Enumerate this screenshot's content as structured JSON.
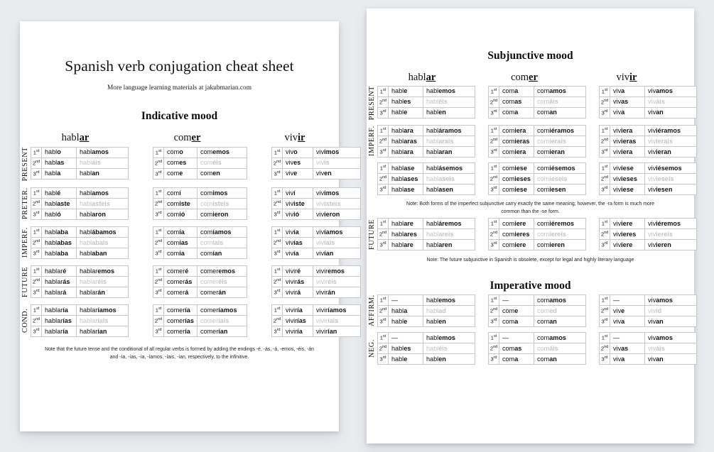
{
  "document": {
    "title": "Spanish verb conjugation cheat sheet",
    "subtitle": "More language learning materials at jakubmarian.com"
  },
  "moods": {
    "indicative": "Indicative mood",
    "subjunctive": "Subjunctive mood",
    "imperative": "Imperative mood"
  },
  "verbs": {
    "hablar": {
      "stem": "habl",
      "ending": "ar"
    },
    "comer": {
      "stem": "com",
      "ending": "er"
    },
    "vivir": {
      "stem": "viv",
      "ending": "ir"
    }
  },
  "persons": {
    "first": "1",
    "second": "2",
    "third": "3",
    "first_sup": "st",
    "second_sup": "nd",
    "third_sup": "rd"
  },
  "tense_labels": {
    "present": "PRESENT",
    "preterite": "PRETER.",
    "imperfect": "IMPERF.",
    "future": "FUTURE",
    "conditional": "COND.",
    "affirmative": "AFFIRM.",
    "negative": "NEG."
  },
  "notes": {
    "future_conditional": "Note that the future tense and the conditional of all regular verbs is formed by adding the endings -é, -ás, -á, -emos, -éis, -án and -ía, -ías, -ía, -íamos, -íais, -ían, respectively, to the infinitive.",
    "imperfect_subjunctive": "Note: Both forms of the imperfect subjunctive carry exactly the same meaning; however, the -ra form is much more common than the -se form.",
    "future_subjunctive": "Note: The future subjunctive in Spanish is obsolete, except for legal and highly literary language"
  },
  "tables": {
    "ind_present": {
      "hablar": [
        [
          "habl",
          "o"
        ],
        [
          "habl",
          "amos"
        ],
        [
          "habl",
          "as"
        ],
        [
          "habl",
          "áis"
        ],
        [
          "habl",
          "a"
        ],
        [
          "habl",
          "an"
        ]
      ],
      "comer": [
        [
          "com",
          "o"
        ],
        [
          "com",
          "emos"
        ],
        [
          "com",
          "es"
        ],
        [
          "com",
          "éis"
        ],
        [
          "com",
          "e"
        ],
        [
          "com",
          "en"
        ]
      ],
      "vivir": [
        [
          "viv",
          "o"
        ],
        [
          "viv",
          "imos"
        ],
        [
          "viv",
          "es"
        ],
        [
          "viv",
          "ís"
        ],
        [
          "viv",
          "e"
        ],
        [
          "viv",
          "en"
        ]
      ]
    },
    "ind_preterite": {
      "hablar": [
        [
          "habl",
          "é"
        ],
        [
          "habl",
          "amos"
        ],
        [
          "habl",
          "aste"
        ],
        [
          "habl",
          "asteis"
        ],
        [
          "habl",
          "ó"
        ],
        [
          "habl",
          "aron"
        ]
      ],
      "comer": [
        [
          "com",
          "í"
        ],
        [
          "com",
          "imos"
        ],
        [
          "com",
          "iste"
        ],
        [
          "com",
          "isteis"
        ],
        [
          "com",
          "ió"
        ],
        [
          "com",
          "ieron"
        ]
      ],
      "vivir": [
        [
          "viv",
          "í"
        ],
        [
          "viv",
          "imos"
        ],
        [
          "viv",
          "iste"
        ],
        [
          "viv",
          "isteis"
        ],
        [
          "viv",
          "ió"
        ],
        [
          "viv",
          "ieron"
        ]
      ]
    },
    "ind_imperfect": {
      "hablar": [
        [
          "habl",
          "aba"
        ],
        [
          "habl",
          "ábamos"
        ],
        [
          "habl",
          "abas"
        ],
        [
          "habl",
          "abais"
        ],
        [
          "habl",
          "aba"
        ],
        [
          "habl",
          "aban"
        ]
      ],
      "comer": [
        [
          "com",
          "ía"
        ],
        [
          "com",
          "íamos"
        ],
        [
          "com",
          "ías"
        ],
        [
          "com",
          "íais"
        ],
        [
          "com",
          "ía"
        ],
        [
          "com",
          "ían"
        ]
      ],
      "vivir": [
        [
          "viv",
          "ía"
        ],
        [
          "viv",
          "íamos"
        ],
        [
          "viv",
          "ías"
        ],
        [
          "viv",
          "íais"
        ],
        [
          "viv",
          "ía"
        ],
        [
          "viv",
          "ían"
        ]
      ]
    },
    "ind_future": {
      "hablar": [
        [
          "hablar",
          "é"
        ],
        [
          "hablar",
          "emos"
        ],
        [
          "hablar",
          "ás"
        ],
        [
          "hablar",
          "éis"
        ],
        [
          "hablar",
          "á"
        ],
        [
          "hablar",
          "án"
        ]
      ],
      "comer": [
        [
          "comer",
          "é"
        ],
        [
          "comer",
          "emos"
        ],
        [
          "comer",
          "ás"
        ],
        [
          "comer",
          "éis"
        ],
        [
          "comer",
          "á"
        ],
        [
          "comer",
          "án"
        ]
      ],
      "vivir": [
        [
          "vivir",
          "é"
        ],
        [
          "vivir",
          "emos"
        ],
        [
          "vivir",
          "ás"
        ],
        [
          "vivir",
          "éis"
        ],
        [
          "vivir",
          "á"
        ],
        [
          "vivir",
          "án"
        ]
      ]
    },
    "ind_conditional": {
      "hablar": [
        [
          "hablar",
          "ía"
        ],
        [
          "hablar",
          "íamos"
        ],
        [
          "hablar",
          "ías"
        ],
        [
          "hablar",
          "íais"
        ],
        [
          "hablar",
          "ía"
        ],
        [
          "hablar",
          "ían"
        ]
      ],
      "comer": [
        [
          "comer",
          "ía"
        ],
        [
          "comer",
          "íamos"
        ],
        [
          "comer",
          "ías"
        ],
        [
          "comer",
          "íais"
        ],
        [
          "comer",
          "ía"
        ],
        [
          "comer",
          "ían"
        ]
      ],
      "vivir": [
        [
          "vivir",
          "ía"
        ],
        [
          "vivir",
          "íamos"
        ],
        [
          "vivir",
          "ías"
        ],
        [
          "vivir",
          "íais"
        ],
        [
          "vivir",
          "ía"
        ],
        [
          "vivir",
          "ían"
        ]
      ]
    },
    "subj_present": {
      "hablar": [
        [
          "habl",
          "e"
        ],
        [
          "habl",
          "emos"
        ],
        [
          "habl",
          "es"
        ],
        [
          "habl",
          "éis"
        ],
        [
          "habl",
          "e"
        ],
        [
          "habl",
          "en"
        ]
      ],
      "comer": [
        [
          "com",
          "a"
        ],
        [
          "com",
          "amos"
        ],
        [
          "com",
          "as"
        ],
        [
          "com",
          "áis"
        ],
        [
          "com",
          "a"
        ],
        [
          "com",
          "an"
        ]
      ],
      "vivir": [
        [
          "viv",
          "a"
        ],
        [
          "viv",
          "amos"
        ],
        [
          "viv",
          "as"
        ],
        [
          "viv",
          "áis"
        ],
        [
          "viv",
          "a"
        ],
        [
          "viv",
          "an"
        ]
      ]
    },
    "subj_imperfect_ra": {
      "hablar": [
        [
          "habl",
          "ara"
        ],
        [
          "habl",
          "áramos"
        ],
        [
          "habl",
          "aras"
        ],
        [
          "habl",
          "arais"
        ],
        [
          "habl",
          "ara"
        ],
        [
          "habl",
          "aran"
        ]
      ],
      "comer": [
        [
          "com",
          "iera"
        ],
        [
          "com",
          "iéramos"
        ],
        [
          "com",
          "ieras"
        ],
        [
          "com",
          "ierais"
        ],
        [
          "com",
          "iera"
        ],
        [
          "com",
          "ieran"
        ]
      ],
      "vivir": [
        [
          "viv",
          "iera"
        ],
        [
          "viv",
          "iéramos"
        ],
        [
          "viv",
          "ieras"
        ],
        [
          "viv",
          "ierais"
        ],
        [
          "viv",
          "iera"
        ],
        [
          "viv",
          "ieran"
        ]
      ]
    },
    "subj_imperfect_se": {
      "hablar": [
        [
          "habl",
          "ase"
        ],
        [
          "habl",
          "ásemos"
        ],
        [
          "habl",
          "ases"
        ],
        [
          "habl",
          "aseis"
        ],
        [
          "habl",
          "ase"
        ],
        [
          "habl",
          "asen"
        ]
      ],
      "comer": [
        [
          "com",
          "iese"
        ],
        [
          "com",
          "iésemos"
        ],
        [
          "com",
          "ieses"
        ],
        [
          "com",
          "ieseis"
        ],
        [
          "com",
          "iese"
        ],
        [
          "com",
          "iesen"
        ]
      ],
      "vivir": [
        [
          "viv",
          "iese"
        ],
        [
          "viv",
          "iésemos"
        ],
        [
          "viv",
          "ieses"
        ],
        [
          "viv",
          "ieseis"
        ],
        [
          "viv",
          "iese"
        ],
        [
          "viv",
          "iesen"
        ]
      ]
    },
    "subj_future": {
      "hablar": [
        [
          "habl",
          "are"
        ],
        [
          "habl",
          "áremos"
        ],
        [
          "habl",
          "ares"
        ],
        [
          "habl",
          "areis"
        ],
        [
          "habl",
          "are"
        ],
        [
          "habl",
          "aren"
        ]
      ],
      "comer": [
        [
          "com",
          "iere"
        ],
        [
          "com",
          "iéremos"
        ],
        [
          "com",
          "ieres"
        ],
        [
          "com",
          "iereis"
        ],
        [
          "com",
          "iere"
        ],
        [
          "com",
          "ieren"
        ]
      ],
      "vivir": [
        [
          "viv",
          "iere"
        ],
        [
          "viv",
          "iéremos"
        ],
        [
          "viv",
          "ieres"
        ],
        [
          "viv",
          "iereis"
        ],
        [
          "viv",
          "iere"
        ],
        [
          "viv",
          "ieren"
        ]
      ]
    },
    "imp_affirmative": {
      "hablar": [
        [
          "",
          ""
        ],
        [
          "habl",
          "emos"
        ],
        [
          "habl",
          "a"
        ],
        [
          "habl",
          "ad"
        ],
        [
          "habl",
          "e"
        ],
        [
          "habl",
          "en"
        ]
      ],
      "comer": [
        [
          "",
          ""
        ],
        [
          "com",
          "amos"
        ],
        [
          "com",
          "e"
        ],
        [
          "com",
          "ed"
        ],
        [
          "com",
          "a"
        ],
        [
          "com",
          "an"
        ]
      ],
      "vivir": [
        [
          "",
          ""
        ],
        [
          "viv",
          "amos"
        ],
        [
          "viv",
          "e"
        ],
        [
          "viv",
          "id"
        ],
        [
          "viv",
          "a"
        ],
        [
          "viv",
          "an"
        ]
      ]
    },
    "imp_negative": {
      "hablar": [
        [
          "",
          ""
        ],
        [
          "habl",
          "emos"
        ],
        [
          "habl",
          "es"
        ],
        [
          "habl",
          "éis"
        ],
        [
          "habl",
          "e"
        ],
        [
          "habl",
          "en"
        ]
      ],
      "comer": [
        [
          "",
          ""
        ],
        [
          "com",
          "amos"
        ],
        [
          "com",
          "as"
        ],
        [
          "com",
          "áis"
        ],
        [
          "com",
          "a"
        ],
        [
          "com",
          "an"
        ]
      ],
      "vivir": [
        [
          "",
          ""
        ],
        [
          "viv",
          "amos"
        ],
        [
          "viv",
          "as"
        ],
        [
          "viv",
          "áis"
        ],
        [
          "viv",
          "a"
        ],
        [
          "viv",
          "an"
        ]
      ]
    }
  },
  "dash": "—",
  "layout": {
    "left_table_widths": {
      "hablar": [
        14,
        44,
        68
      ],
      "comer": [
        14,
        42,
        65
      ],
      "vivir": [
        14,
        38,
        62
      ]
    },
    "right_table_widths": {
      "hablar": [
        14,
        44,
        68
      ],
      "comer": [
        14,
        44,
        68
      ],
      "vivir": [
        14,
        44,
        68
      ]
    }
  }
}
